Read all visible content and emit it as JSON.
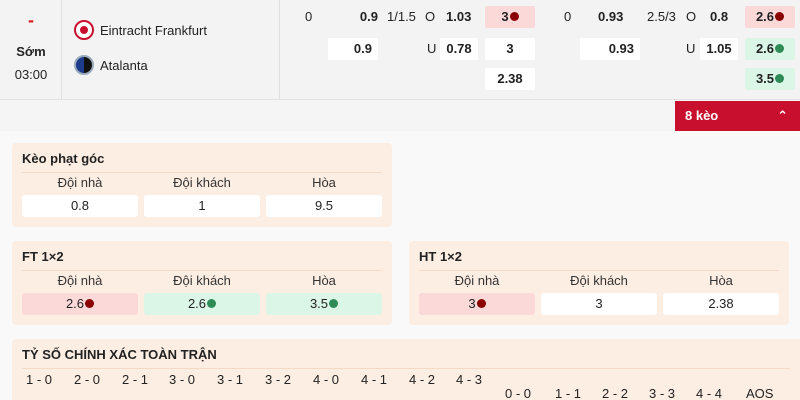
{
  "match": {
    "status_mark": "-",
    "status_label": "Sớm",
    "time": "03:00",
    "home_team": "Eintracht Frankfurt",
    "away_team": "Atalanta"
  },
  "odds_ft": {
    "handicap_line": "0",
    "handicap_home": "0.9",
    "handicap_away": "0.9",
    "ou_line": "1/1.5",
    "over_label": "O",
    "under_label": "U",
    "over": "1.03",
    "under": "0.78",
    "x12_home": "3",
    "x12_away": "3",
    "x12_draw": "2.38"
  },
  "odds_ht": {
    "handicap_line": "0",
    "handicap_home": "0.93",
    "handicap_away": "0.93",
    "ou_line": "2.5/3",
    "over_label": "O",
    "under_label": "U",
    "over": "0.8",
    "under": "1.05",
    "x12_home": "2.6",
    "x12_away": "2.6",
    "x12_draw": "3.5"
  },
  "more_button": {
    "label": "8 kèo",
    "chevron": "⌃"
  },
  "corner_market": {
    "title": "Kèo phạt góc",
    "headers": [
      "Đội nhà",
      "Đội khách",
      "Hòa"
    ],
    "values": [
      "0.8",
      "1",
      "9.5"
    ]
  },
  "ft_1x2": {
    "title": "FT 1×2",
    "headers": [
      "Đội nhà",
      "Đội khách",
      "Hòa"
    ],
    "values": [
      "2.6",
      "2.6",
      "3.5"
    ]
  },
  "ht_1x2": {
    "title": "HT 1×2",
    "headers": [
      "Đội nhà",
      "Đội khách",
      "Hòa"
    ],
    "values": [
      "3",
      "3",
      "2.38"
    ]
  },
  "correct_score": {
    "title": "TỶ SỐ CHÍNH XÁC TOÀN TRẬN",
    "home_scores": [
      "1 - 0",
      "2 - 0",
      "2 - 1",
      "3 - 0",
      "3 - 1",
      "3 - 2",
      "4 - 0",
      "4 - 1",
      "4 - 2",
      "4 - 3"
    ],
    "draw_scores": [
      "0 - 0",
      "1 - 1",
      "2 - 2",
      "3 - 3",
      "4 - 4",
      "AOS"
    ]
  },
  "colors": {
    "accent_red": "#c8102e",
    "odds_down_bg": "#fbd9d9",
    "odds_up_bg": "#dbf5e6",
    "panel_bg": "#fdeee3"
  }
}
